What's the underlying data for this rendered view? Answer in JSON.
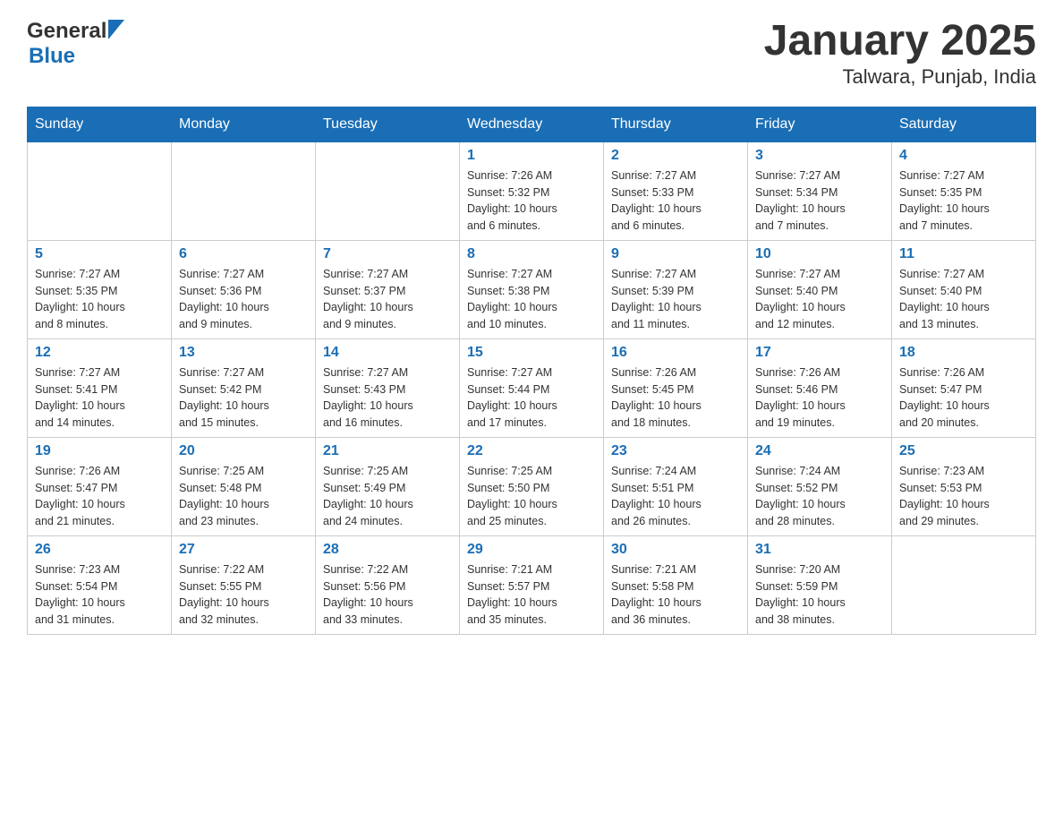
{
  "header": {
    "logo_general": "General",
    "logo_blue": "Blue",
    "title": "January 2025",
    "subtitle": "Talwara, Punjab, India"
  },
  "days_of_week": [
    "Sunday",
    "Monday",
    "Tuesday",
    "Wednesday",
    "Thursday",
    "Friday",
    "Saturday"
  ],
  "weeks": [
    [
      {
        "day": "",
        "info": ""
      },
      {
        "day": "",
        "info": ""
      },
      {
        "day": "",
        "info": ""
      },
      {
        "day": "1",
        "info": "Sunrise: 7:26 AM\nSunset: 5:32 PM\nDaylight: 10 hours\nand 6 minutes."
      },
      {
        "day": "2",
        "info": "Sunrise: 7:27 AM\nSunset: 5:33 PM\nDaylight: 10 hours\nand 6 minutes."
      },
      {
        "day": "3",
        "info": "Sunrise: 7:27 AM\nSunset: 5:34 PM\nDaylight: 10 hours\nand 7 minutes."
      },
      {
        "day": "4",
        "info": "Sunrise: 7:27 AM\nSunset: 5:35 PM\nDaylight: 10 hours\nand 7 minutes."
      }
    ],
    [
      {
        "day": "5",
        "info": "Sunrise: 7:27 AM\nSunset: 5:35 PM\nDaylight: 10 hours\nand 8 minutes."
      },
      {
        "day": "6",
        "info": "Sunrise: 7:27 AM\nSunset: 5:36 PM\nDaylight: 10 hours\nand 9 minutes."
      },
      {
        "day": "7",
        "info": "Sunrise: 7:27 AM\nSunset: 5:37 PM\nDaylight: 10 hours\nand 9 minutes."
      },
      {
        "day": "8",
        "info": "Sunrise: 7:27 AM\nSunset: 5:38 PM\nDaylight: 10 hours\nand 10 minutes."
      },
      {
        "day": "9",
        "info": "Sunrise: 7:27 AM\nSunset: 5:39 PM\nDaylight: 10 hours\nand 11 minutes."
      },
      {
        "day": "10",
        "info": "Sunrise: 7:27 AM\nSunset: 5:40 PM\nDaylight: 10 hours\nand 12 minutes."
      },
      {
        "day": "11",
        "info": "Sunrise: 7:27 AM\nSunset: 5:40 PM\nDaylight: 10 hours\nand 13 minutes."
      }
    ],
    [
      {
        "day": "12",
        "info": "Sunrise: 7:27 AM\nSunset: 5:41 PM\nDaylight: 10 hours\nand 14 minutes."
      },
      {
        "day": "13",
        "info": "Sunrise: 7:27 AM\nSunset: 5:42 PM\nDaylight: 10 hours\nand 15 minutes."
      },
      {
        "day": "14",
        "info": "Sunrise: 7:27 AM\nSunset: 5:43 PM\nDaylight: 10 hours\nand 16 minutes."
      },
      {
        "day": "15",
        "info": "Sunrise: 7:27 AM\nSunset: 5:44 PM\nDaylight: 10 hours\nand 17 minutes."
      },
      {
        "day": "16",
        "info": "Sunrise: 7:26 AM\nSunset: 5:45 PM\nDaylight: 10 hours\nand 18 minutes."
      },
      {
        "day": "17",
        "info": "Sunrise: 7:26 AM\nSunset: 5:46 PM\nDaylight: 10 hours\nand 19 minutes."
      },
      {
        "day": "18",
        "info": "Sunrise: 7:26 AM\nSunset: 5:47 PM\nDaylight: 10 hours\nand 20 minutes."
      }
    ],
    [
      {
        "day": "19",
        "info": "Sunrise: 7:26 AM\nSunset: 5:47 PM\nDaylight: 10 hours\nand 21 minutes."
      },
      {
        "day": "20",
        "info": "Sunrise: 7:25 AM\nSunset: 5:48 PM\nDaylight: 10 hours\nand 23 minutes."
      },
      {
        "day": "21",
        "info": "Sunrise: 7:25 AM\nSunset: 5:49 PM\nDaylight: 10 hours\nand 24 minutes."
      },
      {
        "day": "22",
        "info": "Sunrise: 7:25 AM\nSunset: 5:50 PM\nDaylight: 10 hours\nand 25 minutes."
      },
      {
        "day": "23",
        "info": "Sunrise: 7:24 AM\nSunset: 5:51 PM\nDaylight: 10 hours\nand 26 minutes."
      },
      {
        "day": "24",
        "info": "Sunrise: 7:24 AM\nSunset: 5:52 PM\nDaylight: 10 hours\nand 28 minutes."
      },
      {
        "day": "25",
        "info": "Sunrise: 7:23 AM\nSunset: 5:53 PM\nDaylight: 10 hours\nand 29 minutes."
      }
    ],
    [
      {
        "day": "26",
        "info": "Sunrise: 7:23 AM\nSunset: 5:54 PM\nDaylight: 10 hours\nand 31 minutes."
      },
      {
        "day": "27",
        "info": "Sunrise: 7:22 AM\nSunset: 5:55 PM\nDaylight: 10 hours\nand 32 minutes."
      },
      {
        "day": "28",
        "info": "Sunrise: 7:22 AM\nSunset: 5:56 PM\nDaylight: 10 hours\nand 33 minutes."
      },
      {
        "day": "29",
        "info": "Sunrise: 7:21 AM\nSunset: 5:57 PM\nDaylight: 10 hours\nand 35 minutes."
      },
      {
        "day": "30",
        "info": "Sunrise: 7:21 AM\nSunset: 5:58 PM\nDaylight: 10 hours\nand 36 minutes."
      },
      {
        "day": "31",
        "info": "Sunrise: 7:20 AM\nSunset: 5:59 PM\nDaylight: 10 hours\nand 38 minutes."
      },
      {
        "day": "",
        "info": ""
      }
    ]
  ]
}
